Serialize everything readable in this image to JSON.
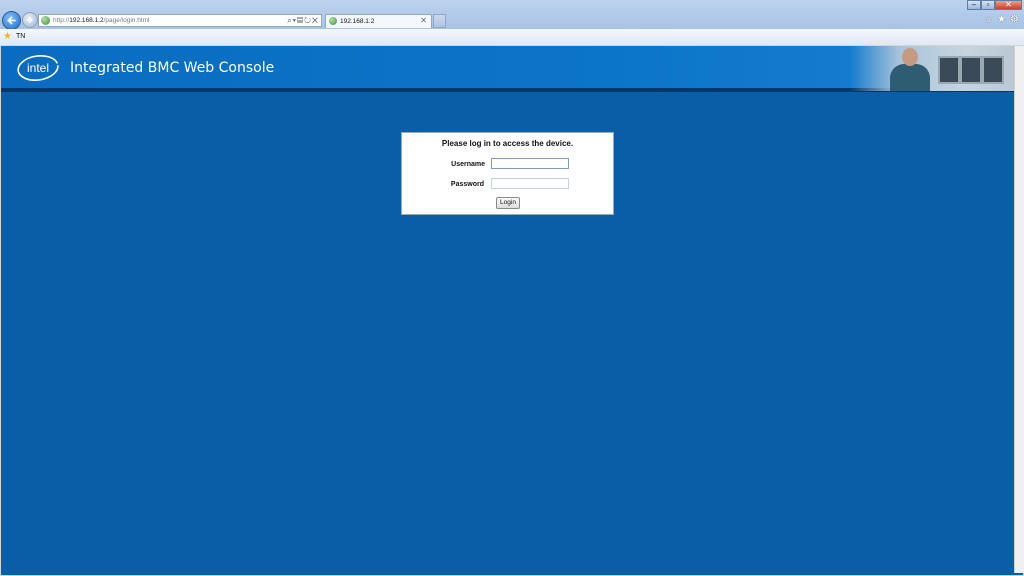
{
  "browser": {
    "address": {
      "prefix": "http://",
      "host": "192.168.1.2",
      "path": "/page/login.html"
    },
    "tab_label": "192.168.1.2",
    "favorites": [
      {
        "label": "TN"
      }
    ]
  },
  "header": {
    "title": "Integrated BMC Web Console",
    "logo_text": "intel",
    "background_color": "#0a6cc0"
  },
  "login": {
    "prompt": "Please log in to access the device.",
    "username_label": "Username",
    "username_value": "",
    "password_label": "Password",
    "password_value": "",
    "button_label": "Login"
  },
  "colors": {
    "page_background": "#0a5ea8"
  }
}
